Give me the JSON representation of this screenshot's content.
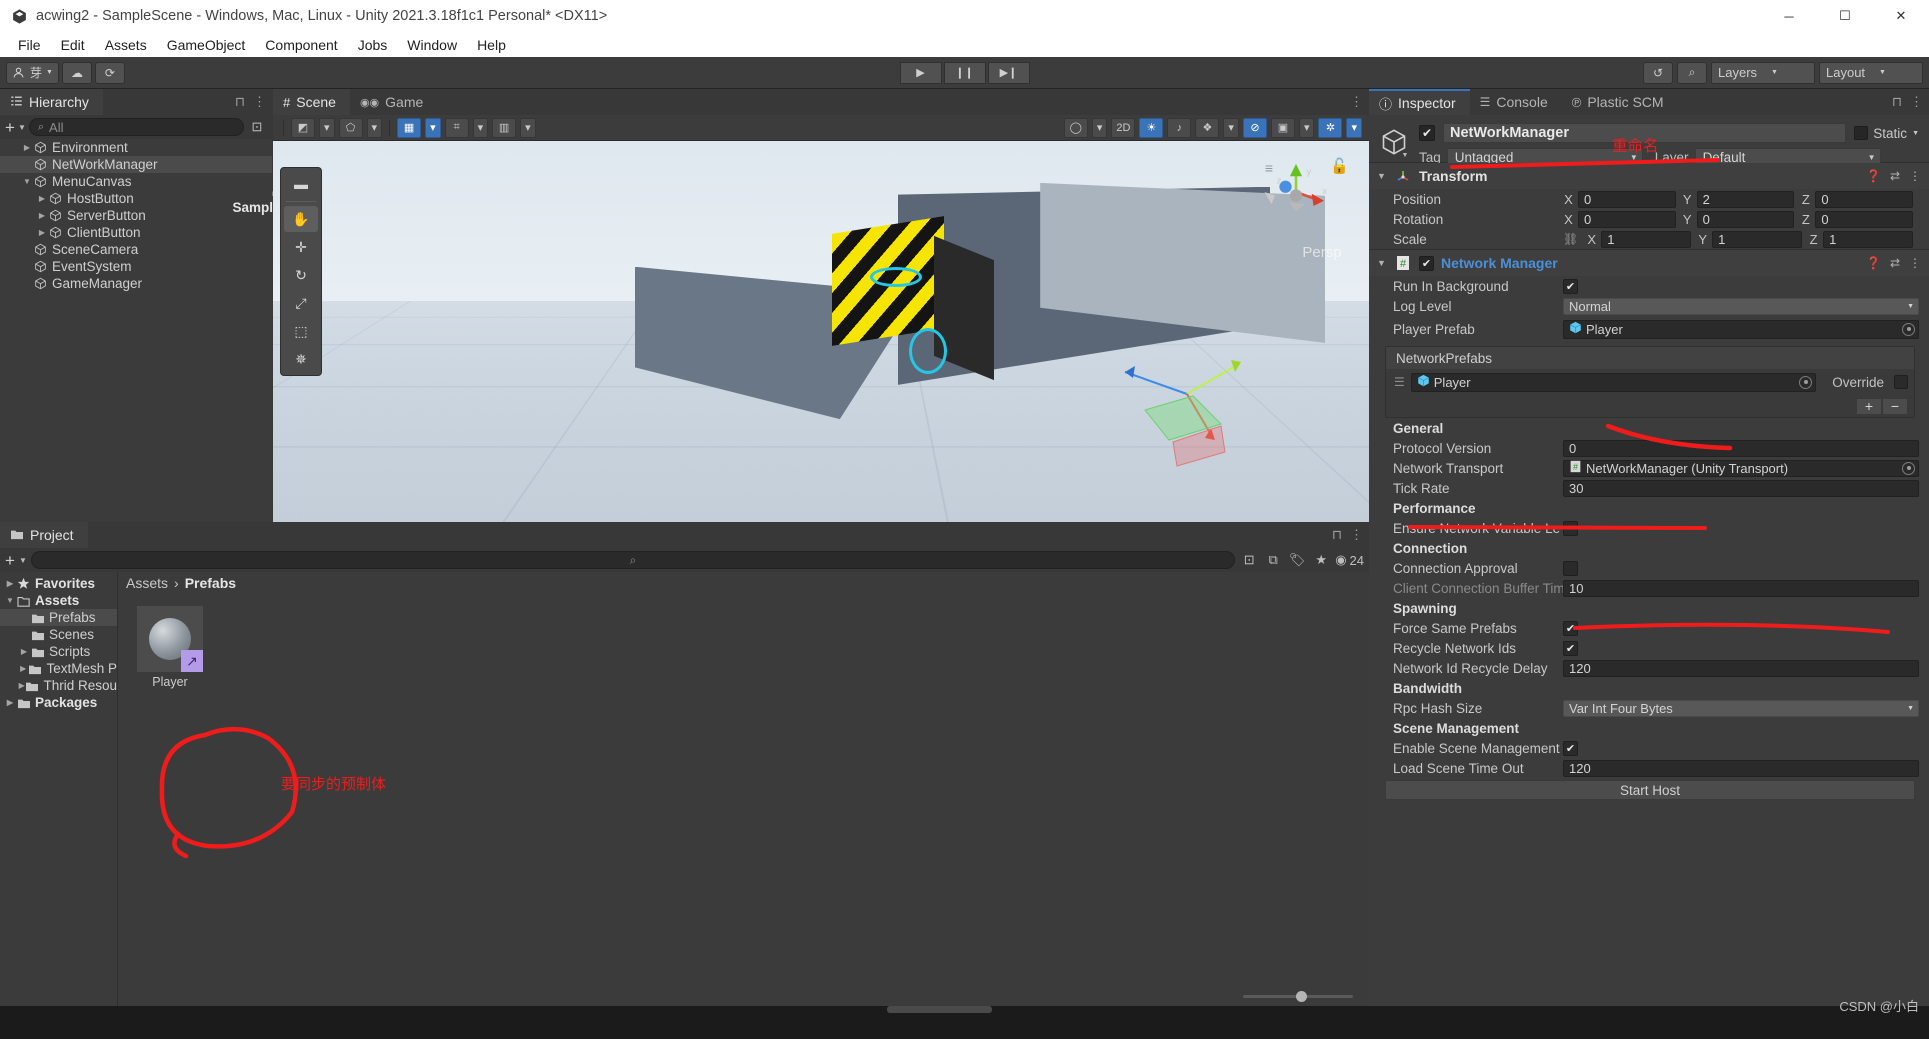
{
  "window": {
    "title": "acwing2 - SampleScene - Windows, Mac, Linux - Unity 2021.3.18f1c1 Personal* <DX11>",
    "minimize": "─",
    "maximize": "☐",
    "close": "✕"
  },
  "menubar": [
    "File",
    "Edit",
    "Assets",
    "GameObject",
    "Component",
    "Jobs",
    "Window",
    "Help"
  ],
  "toolbar": {
    "account_label": "芽",
    "play": "▶",
    "pause": "❙❙",
    "step": "▶❙",
    "layers_label": "Layers",
    "layout_label": "Layout",
    "undo_icon": "↺",
    "search_icon": "⌕",
    "cloud_icon": "☁",
    "collab_icon": "⟳"
  },
  "hierarchy": {
    "tab": "Hierarchy",
    "search_placeholder": "All",
    "add_label": "+",
    "items": [
      {
        "label": "SampleScene*",
        "depth": 0,
        "tri": "▼",
        "type": "scene",
        "selected": true
      },
      {
        "label": "Environment",
        "depth": 1,
        "tri": "▶",
        "type": "go",
        "selected": false
      },
      {
        "label": "NetWorkManager",
        "depth": 1,
        "tri": "",
        "type": "go",
        "selected": true
      },
      {
        "label": "MenuCanvas",
        "depth": 1,
        "tri": "▼",
        "type": "go",
        "selected": false
      },
      {
        "label": "HostButton",
        "depth": 2,
        "tri": "▶",
        "type": "go",
        "selected": false
      },
      {
        "label": "ServerButton",
        "depth": 2,
        "tri": "▶",
        "type": "go",
        "selected": false
      },
      {
        "label": "ClientButton",
        "depth": 2,
        "tri": "▶",
        "type": "go",
        "selected": false
      },
      {
        "label": "SceneCamera",
        "depth": 1,
        "tri": "",
        "type": "go",
        "selected": false
      },
      {
        "label": "EventSystem",
        "depth": 1,
        "tri": "",
        "type": "go",
        "selected": false
      },
      {
        "label": "GameManager",
        "depth": 1,
        "tri": "",
        "type": "go",
        "selected": false
      }
    ]
  },
  "scene": {
    "tabs": [
      {
        "label": "Scene",
        "icon": "#",
        "active": true
      },
      {
        "label": "Game",
        "icon": "◎◎",
        "active": false
      }
    ],
    "toolbar": {
      "shading": "◨",
      "twod": "2D",
      "light": "☀",
      "audio": "♪",
      "fx": "❖",
      "hidden": "⊘",
      "camera": "▣",
      "gizmos": "✲"
    },
    "persp_label": "Persp",
    "tools": [
      "✥",
      "✣",
      "↻",
      "⤡",
      "⬚",
      "✹"
    ],
    "axis_labels": {
      "x": "x",
      "y": "y",
      "z": "z"
    }
  },
  "project": {
    "tab": "Project",
    "search_placeholder": "",
    "tree": [
      {
        "label": "Favorites",
        "depth": 0,
        "tri": "▶",
        "icon": "★",
        "bold": true,
        "selected": false
      },
      {
        "label": "Assets",
        "depth": 0,
        "tri": "▼",
        "icon": "🗀",
        "bold": true,
        "selected": false
      },
      {
        "label": "Prefabs",
        "depth": 1,
        "tri": "",
        "icon": "🗀",
        "bold": false,
        "selected": true
      },
      {
        "label": "Scenes",
        "depth": 1,
        "tri": "",
        "icon": "🗀",
        "bold": false,
        "selected": false
      },
      {
        "label": "Scripts",
        "depth": 1,
        "tri": "▶",
        "icon": "🗀",
        "bold": false,
        "selected": false
      },
      {
        "label": "TextMesh P",
        "depth": 1,
        "tri": "▶",
        "icon": "🗀",
        "bold": false,
        "selected": false
      },
      {
        "label": "Thrid Resou",
        "depth": 1,
        "tri": "▶",
        "icon": "🗀",
        "bold": false,
        "selected": false
      },
      {
        "label": "Packages",
        "depth": 0,
        "tri": "▶",
        "icon": "🗀",
        "bold": true,
        "selected": false
      }
    ],
    "breadcrumb": {
      "root": "Assets",
      "sep": "›",
      "current": "Prefabs"
    },
    "assets": [
      {
        "label": "Player",
        "badge": "↗"
      }
    ],
    "file_count": "24"
  },
  "inspector": {
    "tabs": [
      {
        "label": "Inspector",
        "icon": "ⓘ",
        "active": true
      },
      {
        "label": "Console",
        "icon": "☰",
        "active": false
      },
      {
        "label": "Plastic SCM",
        "icon": "Ⓟ",
        "active": false
      }
    ],
    "object": {
      "name": "NetWorkManager",
      "enabled": true,
      "static_label": "Static",
      "tag_label": "Tag",
      "tag_value": "Untagged",
      "layer_label": "Layer",
      "layer_value": "Default"
    },
    "transform": {
      "title": "Transform",
      "rows": [
        {
          "label": "Position",
          "x": "0",
          "y": "2",
          "z": "0",
          "lock": false
        },
        {
          "label": "Rotation",
          "x": "0",
          "y": "0",
          "z": "0",
          "lock": false
        },
        {
          "label": "Scale",
          "x": "1",
          "y": "1",
          "z": "1",
          "lock": true
        }
      ],
      "axes": [
        "X",
        "Y",
        "Z"
      ]
    },
    "network_manager": {
      "title": "Network Manager",
      "enabled": true,
      "run_in_background": {
        "label": "Run In Background",
        "value": true
      },
      "log_level": {
        "label": "Log Level",
        "value": "Normal"
      },
      "player_prefab": {
        "label": "Player Prefab",
        "value": "Player"
      },
      "network_prefabs": {
        "header": "NetworkPrefabs",
        "rows": [
          {
            "value": "Player",
            "override_label": "Override",
            "override_checked": false
          }
        ],
        "add": "+",
        "remove": "−"
      },
      "sections": [
        {
          "name": "General",
          "rows": [
            {
              "label": "Protocol Version",
              "value": "0",
              "kind": "text"
            },
            {
              "label": "Network Transport",
              "value": "NetWorkManager (Unity Transport)",
              "kind": "objref"
            },
            {
              "label": "Tick Rate",
              "value": "30",
              "kind": "text"
            }
          ]
        },
        {
          "name": "Performance",
          "rows": [
            {
              "label": "Ensure Network Variable Le",
              "value": false,
              "kind": "check"
            }
          ]
        },
        {
          "name": "Connection",
          "rows": [
            {
              "label": "Connection Approval",
              "value": false,
              "kind": "check"
            },
            {
              "label": "Client Connection Buffer Tim",
              "value": "10",
              "kind": "text",
              "dim": true
            }
          ]
        },
        {
          "name": "Spawning",
          "rows": [
            {
              "label": "Force Same Prefabs",
              "value": true,
              "kind": "check"
            },
            {
              "label": "Recycle Network Ids",
              "value": true,
              "kind": "check"
            },
            {
              "label": "Network Id Recycle Delay",
              "value": "120",
              "kind": "text"
            }
          ]
        },
        {
          "name": "Bandwidth",
          "rows": [
            {
              "label": "Rpc Hash Size",
              "value": "Var Int Four Bytes",
              "kind": "dropdown"
            }
          ]
        },
        {
          "name": "Scene Management",
          "rows": [
            {
              "label": "Enable Scene Management",
              "value": true,
              "kind": "check"
            },
            {
              "label": "Load Scene Time Out",
              "value": "120",
              "kind": "text"
            }
          ]
        }
      ],
      "start_host_label": "Start Host"
    }
  },
  "annotations": {
    "rename": "重命名",
    "prefab_note": "要同步的预制体",
    "color": "#f01c1c"
  },
  "watermark": "CSDN @小白"
}
